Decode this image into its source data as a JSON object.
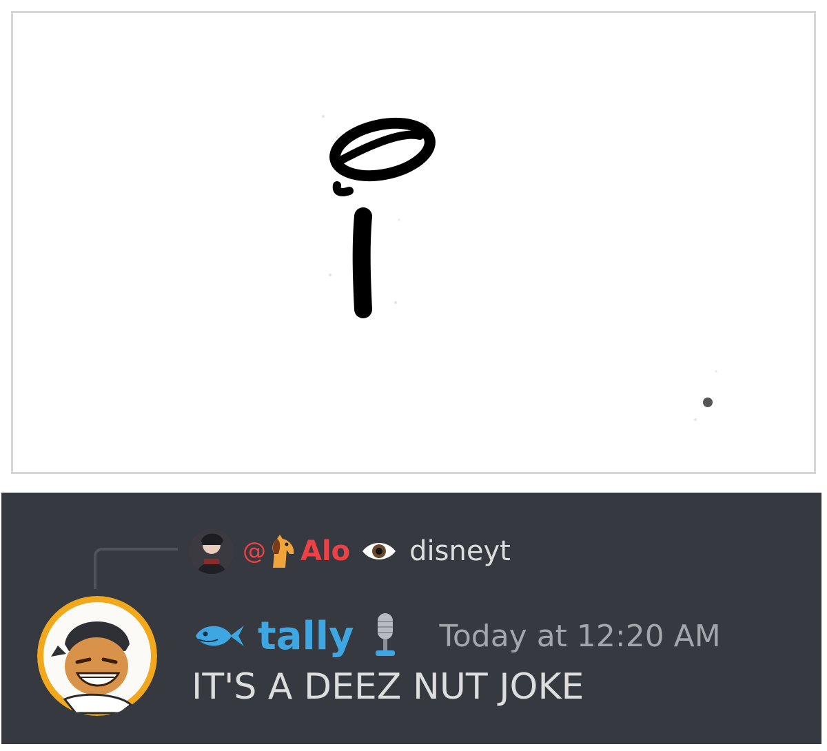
{
  "reply": {
    "at_symbol": "@",
    "author": "Alo",
    "text": "disneyt",
    "author_color": "#ed4245"
  },
  "message": {
    "username": "tally",
    "username_color": "#3ea6e0",
    "timestamp": "Today at 12:20 AM",
    "text": "IT'S A DEEZ NUT JOKE"
  },
  "icons": {
    "reply_avatar": "anime-avatar",
    "reply_prefix": "horse-emoji",
    "reply_suffix": "eye-emoji",
    "user_prefix": "fish-icon",
    "user_suffix": "microphone-icon",
    "avatar": "grinning-cartoon-avatar"
  },
  "colors": {
    "chat_background": "#36393f",
    "text": "#dcddde",
    "muted": "#a3a6aa"
  }
}
